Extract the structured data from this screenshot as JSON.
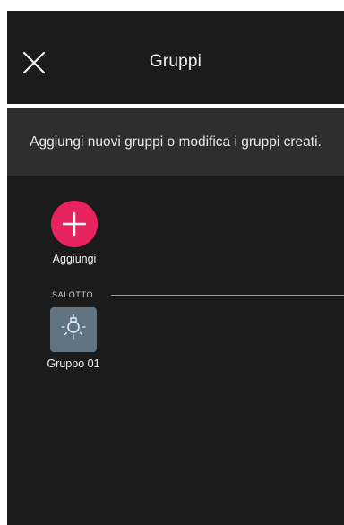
{
  "header": {
    "title": "Gruppi",
    "close_icon": "close-icon"
  },
  "subheader": {
    "text": "Aggiungi nuovi gruppi o modifica i gruppi creati."
  },
  "add": {
    "label": "Aggiungi",
    "icon": "plus-icon",
    "color": "#e8245f"
  },
  "sections": [
    {
      "title": "SALOTTO",
      "groups": [
        {
          "label": "Gruppo 01",
          "icon": "light-bulb-icon",
          "color": "#5f7383"
        }
      ]
    }
  ]
}
